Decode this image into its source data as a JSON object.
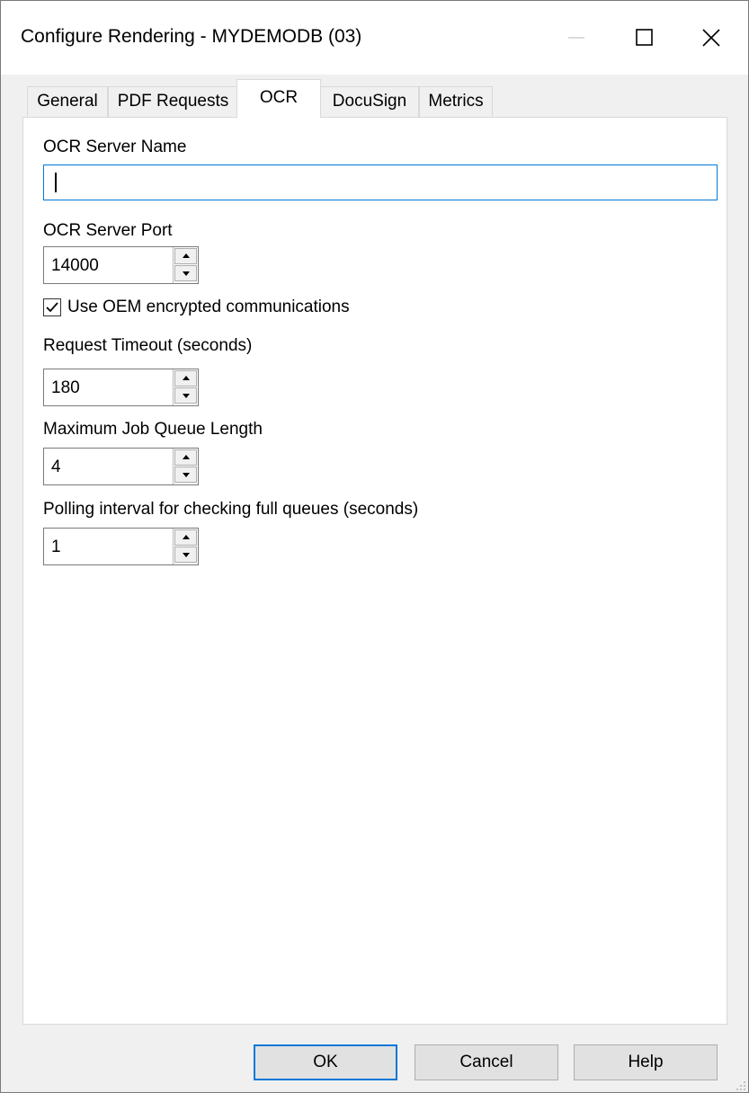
{
  "window": {
    "title": "Configure Rendering - MYDEMODB (03)",
    "controls": {
      "minimize": "minimize-icon",
      "maximize": "maximize-icon",
      "close": "close-icon"
    }
  },
  "tabs": [
    {
      "label": "General"
    },
    {
      "label": "PDF Requests"
    },
    {
      "label": "OCR",
      "active": true
    },
    {
      "label": "DocuSign"
    },
    {
      "label": "Metrics"
    }
  ],
  "ocr": {
    "server_name": {
      "label": "OCR Server Name",
      "value": ""
    },
    "server_port": {
      "label": "OCR Server Port",
      "value": "14000"
    },
    "oem_encryption": {
      "label": "Use OEM encrypted communications",
      "checked": true
    },
    "request_timeout": {
      "label": "Request Timeout (seconds)",
      "value": "180"
    },
    "max_queue": {
      "label": "Maximum Job Queue Length",
      "value": "4"
    },
    "polling_interval": {
      "label": "Polling interval for checking full queues (seconds)",
      "value": "1"
    }
  },
  "buttons": {
    "ok": "OK",
    "cancel": "Cancel",
    "help": "Help"
  },
  "colors": {
    "accent": "#0078d7",
    "dialog_background": "#f0f0f0",
    "panel_background": "#ffffff"
  }
}
